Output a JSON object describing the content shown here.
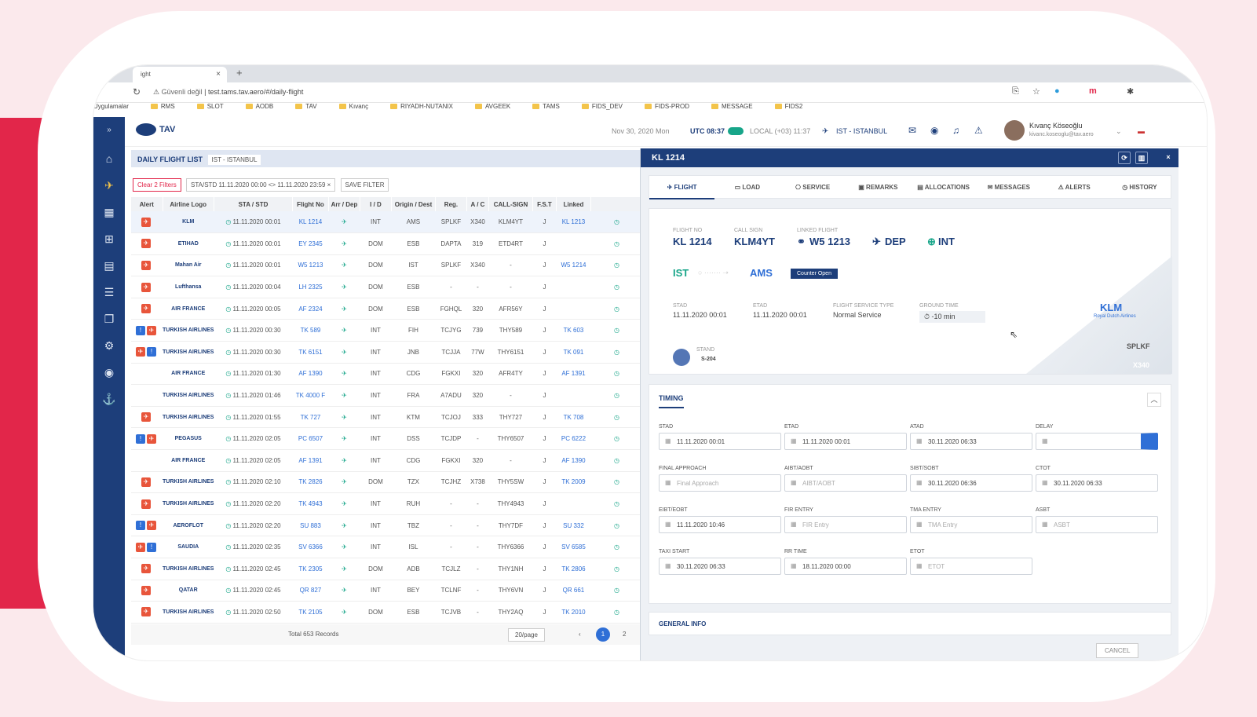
{
  "browser": {
    "tab_title": "ight",
    "url_warning": "Güvenli değil",
    "url": "test.tams.tav.aero/#/daily-flight",
    "bookmarks": [
      "Uygulamalar",
      "RMS",
      "SLOT",
      "AODB",
      "TAV",
      "Kıvanç",
      "RIYADH-NUTANIX",
      "AVGEEK",
      "TAMS",
      "FIDS_DEV",
      "FIDS-PROD",
      "MESSAGE",
      "FIDS2"
    ]
  },
  "app": {
    "logo_text": "TAV",
    "date": "Nov 30, 2020 Mon",
    "utc": "UTC 08:37",
    "local": "LOCAL (+03) 11:37",
    "airport": "IST - ISTANBUL",
    "user_name": "Kıvanç Köseoğlu",
    "user_email": "kivanc.koseoglu@tav.aero"
  },
  "list": {
    "title": "DAILY FLIGHT LIST",
    "airport_chip": "IST - ISTANBUL",
    "clear_filters": "Clear 2 Filters",
    "date_filter": "STA/STD 11.11.2020 00:00 <> 11.11.2020 23:59 ×",
    "save_filter": "SAVE FILTER",
    "columns": [
      "Alert",
      "Airline Logo",
      "STA / STD",
      "Flight No",
      "Arr / Dep",
      "I / D",
      "Origin / Dest",
      "Reg.",
      "A / C",
      "CALL-SIGN",
      "F.S.T",
      "Linked"
    ],
    "rows": [
      {
        "alert": "r",
        "airline": "KLM",
        "time": "11.11.2020 00:01",
        "flight": "KL 1214",
        "id": "INT",
        "dest": "AMS",
        "reg": "SPLKF",
        "ac": "X340",
        "cs": "KLM4YT",
        "fst": "J",
        "linked": "KL 1213"
      },
      {
        "alert": "r",
        "airline": "ETIHAD",
        "time": "11.11.2020 00:01",
        "flight": "EY 2345",
        "id": "DOM",
        "dest": "ESB",
        "reg": "DAPTA",
        "ac": "319",
        "cs": "ETD4RT",
        "fst": "J",
        "linked": ""
      },
      {
        "alert": "r",
        "airline": "Mahan Air",
        "time": "11.11.2020 00:01",
        "flight": "W5 1213",
        "id": "DOM",
        "dest": "IST",
        "reg": "SPLKF",
        "ac": "X340",
        "cs": "-",
        "fst": "J",
        "linked": "W5 1214"
      },
      {
        "alert": "r",
        "airline": "Lufthansa",
        "time": "11.11.2020 00:04",
        "flight": "LH 2325",
        "id": "DOM",
        "dest": "ESB",
        "reg": "-",
        "ac": "-",
        "cs": "-",
        "fst": "J",
        "linked": ""
      },
      {
        "alert": "r",
        "airline": "AIR FRANCE",
        "time": "11.11.2020 00:05",
        "flight": "AF 2324",
        "id": "DOM",
        "dest": "ESB",
        "reg": "FGHQL",
        "ac": "320",
        "cs": "AFR56Y",
        "fst": "J",
        "linked": ""
      },
      {
        "alert": "br",
        "airline": "TURKISH AIRLINES",
        "time": "11.11.2020 00:30",
        "flight": "TK 589",
        "id": "INT",
        "dest": "FIH",
        "reg": "TCJYG",
        "ac": "739",
        "cs": "THY589",
        "fst": "J",
        "linked": "TK 603"
      },
      {
        "alert": "rb",
        "airline": "TURKISH AIRLINES",
        "time": "11.11.2020 00:30",
        "flight": "TK 6151",
        "id": "INT",
        "dest": "JNB",
        "reg": "TCJJA",
        "ac": "77W",
        "cs": "THY6151",
        "fst": "J",
        "linked": "TK 091"
      },
      {
        "alert": "",
        "airline": "AIR FRANCE",
        "time": "11.11.2020 01:30",
        "flight": "AF 1390",
        "id": "INT",
        "dest": "CDG",
        "reg": "FGKXI",
        "ac": "320",
        "cs": "AFR4TY",
        "fst": "J",
        "linked": "AF 1391"
      },
      {
        "alert": "",
        "airline": "TURKISH AIRLINES",
        "time": "11.11.2020 01:46",
        "flight": "TK 4000 F",
        "id": "INT",
        "dest": "FRA",
        "reg": "A7ADU",
        "ac": "320",
        "cs": "-",
        "fst": "J",
        "linked": ""
      },
      {
        "alert": "r",
        "airline": "TURKISH AIRLINES",
        "time": "11.11.2020 01:55",
        "flight": "TK 727",
        "id": "INT",
        "dest": "KTM",
        "reg": "TCJOJ",
        "ac": "333",
        "cs": "THY727",
        "fst": "J",
        "linked": "TK 708"
      },
      {
        "alert": "br",
        "airline": "PEGASUS",
        "time": "11.11.2020 02:05",
        "flight": "PC 6507",
        "id": "INT",
        "dest": "DSS",
        "reg": "TCJDP",
        "ac": "-",
        "cs": "THY6507",
        "fst": "J",
        "linked": "PC 6222"
      },
      {
        "alert": "",
        "airline": "AIR FRANCE",
        "time": "11.11.2020 02:05",
        "flight": "AF 1391",
        "id": "INT",
        "dest": "CDG",
        "reg": "FGKXI",
        "ac": "320",
        "cs": "-",
        "fst": "J",
        "linked": "AF 1390"
      },
      {
        "alert": "r",
        "airline": "TURKISH AIRLINES",
        "time": "11.11.2020 02:10",
        "flight": "TK 2826",
        "id": "DOM",
        "dest": "TZX",
        "reg": "TCJHZ",
        "ac": "X738",
        "cs": "THY5SW",
        "fst": "J",
        "linked": "TK 2009"
      },
      {
        "alert": "r",
        "airline": "TURKISH AIRLINES",
        "time": "11.11.2020 02:20",
        "flight": "TK 4943",
        "id": "INT",
        "dest": "RUH",
        "reg": "-",
        "ac": "-",
        "cs": "THY4943",
        "fst": "J",
        "linked": ""
      },
      {
        "alert": "br",
        "airline": "AEROFLOT",
        "time": "11.11.2020 02:20",
        "flight": "SU 883",
        "id": "INT",
        "dest": "TBZ",
        "reg": "-",
        "ac": "-",
        "cs": "THY7DF",
        "fst": "J",
        "linked": "SU 332"
      },
      {
        "alert": "rb",
        "airline": "SAUDIA",
        "time": "11.11.2020 02:35",
        "flight": "SV 6366",
        "id": "INT",
        "dest": "ISL",
        "reg": "-",
        "ac": "-",
        "cs": "THY6366",
        "fst": "J",
        "linked": "SV 6585"
      },
      {
        "alert": "r",
        "airline": "TURKISH AIRLINES",
        "time": "11.11.2020 02:45",
        "flight": "TK 2305",
        "id": "DOM",
        "dest": "ADB",
        "reg": "TCJLZ",
        "ac": "-",
        "cs": "THY1NH",
        "fst": "J",
        "linked": "TK 2806"
      },
      {
        "alert": "r",
        "airline": "QATAR",
        "time": "11.11.2020 02:45",
        "flight": "QR 827",
        "id": "INT",
        "dest": "BEY",
        "reg": "TCLNF",
        "ac": "-",
        "cs": "THY6VN",
        "fst": "J",
        "linked": "QR 661"
      },
      {
        "alert": "r",
        "airline": "TURKISH AIRLINES",
        "time": "11.11.2020 02:50",
        "flight": "TK 2105",
        "id": "DOM",
        "dest": "ESB",
        "reg": "TCJVB",
        "ac": "-",
        "cs": "THY2AQ",
        "fst": "J",
        "linked": "TK 2010"
      }
    ],
    "total": "Total 653 Records",
    "page_size": "20/page",
    "page_current": "1",
    "page_next": "2"
  },
  "detail": {
    "title": "KL 1214",
    "tabs": [
      "FLIGHT",
      "LOAD",
      "SERVICE",
      "REMARKS",
      "ALLOCATIONS",
      "MESSAGES",
      "ALERTS",
      "HISTORY"
    ],
    "flight_no_label": "Flight No",
    "flight_no": "KL 1214",
    "call_sign_label": "Call Sign",
    "call_sign": "KLM4YT",
    "linked_label": "Linked Flight",
    "linked": "W5 1213",
    "direction": "DEP",
    "int_dom": "INT",
    "origin": "IST",
    "destination": "AMS",
    "counter_badge": "Counter Open",
    "stad_label": "STAD",
    "stad": "11.11.2020 00:01",
    "etad_label": "ETAD",
    "etad": "11.11.2020 00:01",
    "fst_label": "FLIGHT SERVICE TYPE",
    "fst": "Normal Service",
    "ground_label": "GROUND TIME",
    "ground": "-10 min",
    "stand_label": "STAND",
    "stand": "S-204",
    "tail_reg": "SPLKF",
    "tail_ac": "X340",
    "tail_logo": "KLM",
    "tail_sub": "Royal Dutch Airlines",
    "timing_title": "TIMING",
    "timing_fields": [
      {
        "label": "STAD",
        "value": "11.11.2020 00:01",
        "ph": false
      },
      {
        "label": "ETAD",
        "value": "11.11.2020 00:01",
        "ph": false
      },
      {
        "label": "ATAD",
        "value": "30.11.2020 06:33",
        "ph": false
      },
      {
        "label": "DELAY",
        "value": "",
        "ph": false
      },
      {
        "label": "FINAL APPROACH",
        "value": "Final Approach",
        "ph": true
      },
      {
        "label": "AIBT/AOBT",
        "value": "AIBT/AOBT",
        "ph": true
      },
      {
        "label": "SIBT/SOBT",
        "value": "30.11.2020 06:36",
        "ph": false
      },
      {
        "label": "CTOT",
        "value": "30.11.2020 06:33",
        "ph": false
      },
      {
        "label": "EIBT/EOBT",
        "value": "11.11.2020 10:46",
        "ph": false
      },
      {
        "label": "FIR ENTRY",
        "value": "FIR Entry",
        "ph": true
      },
      {
        "label": "TMA ENTRY",
        "value": "TMA Entry",
        "ph": true
      },
      {
        "label": "ASBT",
        "value": "ASBT",
        "ph": true
      },
      {
        "label": "TAXI START",
        "value": "30.11.2020 06:33",
        "ph": false
      },
      {
        "label": "RR TIME",
        "value": "18.11.2020 00:00",
        "ph": false
      },
      {
        "label": "ETOT",
        "value": "ETOT",
        "ph": true
      }
    ],
    "general_info": "GENERAL INFO",
    "cancel": "CANCEL"
  }
}
